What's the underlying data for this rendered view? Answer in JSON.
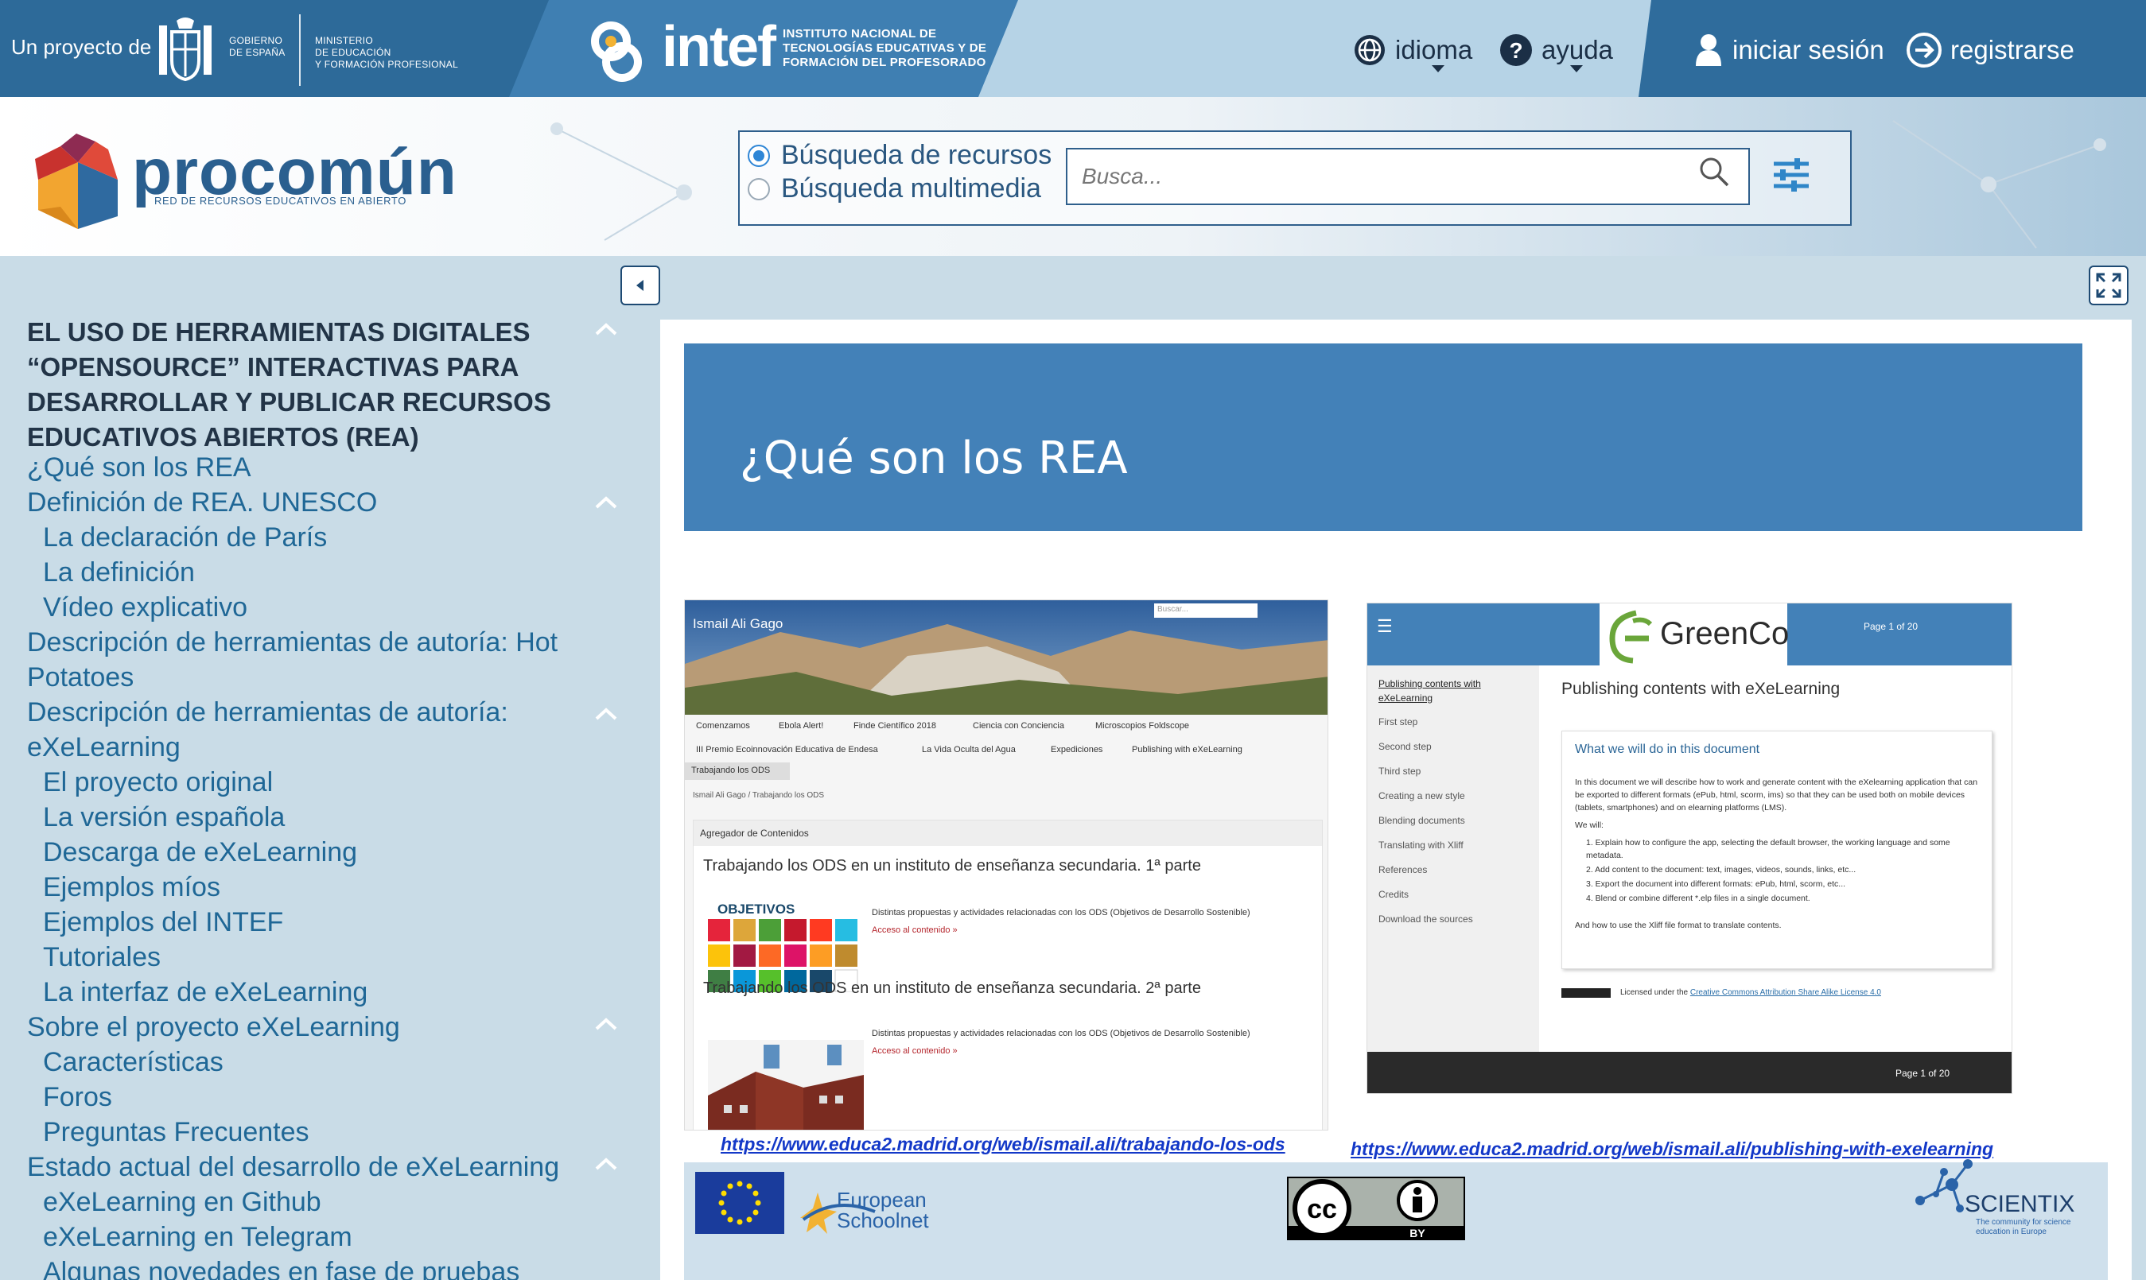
{
  "topbar": {
    "proyecto": "Un proyecto de",
    "gobierno": "GOBIERNO\nDE ESPAÑA",
    "ministerio": "MINISTERIO\nDE EDUCACIÓN\nY FORMACIÓN PROFESIONAL",
    "intef_word": "intef",
    "intef_sub": "INSTITUTO NACIONAL DE\nTECNOLOGÍAS EDUCATIVAS Y DE\nFORMACIÓN DEL PROFESORADO",
    "nav": {
      "idioma": "idioma",
      "ayuda": "ayuda",
      "login": "iniciar sesión",
      "register": "registrarse"
    }
  },
  "header": {
    "logo_word": "procomún",
    "logo_sub": "RED DE RECURSOS EDUCATIVOS EN ABIERTO",
    "search": {
      "option_resources": "Búsqueda de recursos",
      "option_multimedia": "Búsqueda multimedia",
      "selected": "Búsqueda de recursos",
      "placeholder": "Busca..."
    }
  },
  "sidebar": {
    "title": "EL USO DE HERRAMIENTAS DIGITALES “OPENSOURCE” INTERACTIVAS PARA DESARROLLAR Y PUBLICAR RECURSOS EDUCATIVOS ABIERTOS (REA)",
    "items": [
      "¿Qué son los REA",
      "Definición de REA. UNESCO",
      "La declaración de París",
      "La definición",
      "Vídeo explicativo",
      "Descripción de herramientas de autoría: Hot",
      "Potatoes",
      "Descripción de herramientas de autoría:",
      "eXeLearning",
      "El proyecto original",
      "La versión española",
      "Descarga de eXeLearning",
      "Ejemplos míos",
      "Ejemplos del INTEF",
      "Tutoriales",
      "La interfaz de eXeLearning",
      "Sobre el proyecto eXeLearning",
      "Características",
      "Foros",
      "Preguntas Frecuentes",
      "Estado actual del desarrollo de eXeLearning",
      "eXeLearning en Github",
      "eXeLearning en Telegram",
      "Algunas novedades en fase de pruebas"
    ]
  },
  "main": {
    "title": "¿Qué son los REA",
    "shot1": {
      "name": "Ismail Ali Gago",
      "search": "Buscar...",
      "nav_row1": [
        "Comenzamos",
        "Ebola Alert!",
        "Finde Científico 2018",
        "Ciencia con Conciencia",
        "Microscopios Foldscope"
      ],
      "nav_row2": [
        "III Premio Ecoinnovación Educativa de Endesa",
        "La Vida Oculta del Agua",
        "Expediciones",
        "Publishing with eXeLearning"
      ],
      "active_tab": "Trabajando los ODS",
      "breadcrumb": "Ismail Ali Gago / Trabajando los ODS",
      "card_header": "Agregador de Contenidos",
      "entry1_title": "Trabajando los ODS en un instituto de enseñanza secundaria. 1ª parte",
      "entry2_title": "Trabajando los ODS en un instituto de enseñanza secundaria. 2ª parte",
      "entry_desc": "Distintas propuestas y actividades relacionadas con los ODS (Objetivos de Desarrollo Sostenible)",
      "entry_link": "Acceso al contenido »",
      "ods_label": "OBJETIVOS"
    },
    "shot2": {
      "brand": "GreenCo",
      "page": "Page 1 of 20",
      "side_active": "Publishing contents with eXeLearning",
      "side_items": [
        "First step",
        "Second step",
        "Third step",
        "Creating a new style",
        "Blending documents",
        "Translating with Xliff",
        "References",
        "Credits",
        "Download the sources"
      ],
      "heading": "Publishing contents with eXeLearning",
      "box_title": "What we will do in this document",
      "para1": "In this document we will describe how to work and generate content with the eXelearning application that can be exported to different formats (ePub, html, scorm, ims) so that they can be used both on mobile devices (tablets, smartphones) and on elearning platforms (LMS).",
      "para2": "We will:",
      "list": [
        "1. Explain how to configure the app, selecting the default browser, the working language and some metadata.",
        "2. Add content to the document: text, images, videos, sounds, links, etc...",
        "3. Export the document into different formats: ePub, html, scorm, etc...",
        "4. Blend or combine different *.elp files in a single document."
      ],
      "para3": "And how to use the Xliff file format to translate contents.",
      "license_prefix": "Licensed under the",
      "license_link": "Creative Commons Attribution Share Alike License 4.0"
    },
    "link1": "https://www.educa2.madrid.org/web/ismail.ali/trabajando-los-ods",
    "link2": "https://www.educa2.madrid.org/web/ismail.ali/publishing-with-exelearning",
    "footer": {
      "eun": "European\nSchoolnet",
      "cc": "BY",
      "scientix": "SCIENTIX",
      "scientix_sub": "The community for science\neducation in Europe"
    }
  },
  "colors": {
    "gov_band": "#2d6a99",
    "intef_band": "#3f7fb2",
    "title_banner": "#4381b8",
    "toc_link": "#1f6796",
    "link": "#1338c8"
  }
}
